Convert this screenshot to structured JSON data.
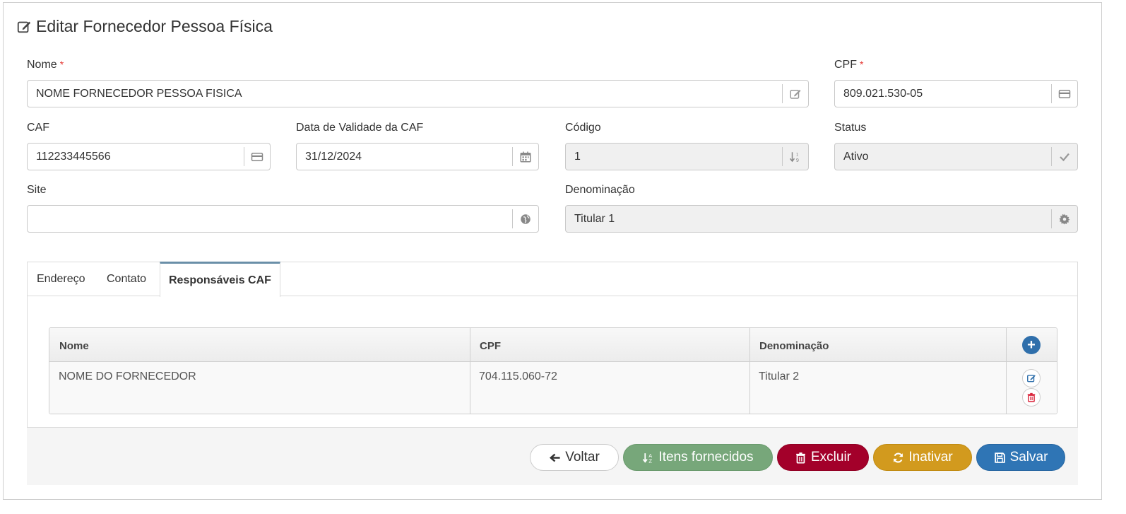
{
  "page": {
    "title": "Editar Fornecedor Pessoa Física"
  },
  "form": {
    "nome": {
      "label": "Nome",
      "required": "*",
      "value": "NOME FORNECEDOR PESSOA FISICA",
      "icon": "edit-icon"
    },
    "cpf": {
      "label": "CPF",
      "required": "*",
      "value": "809.021.530-05",
      "icon": "card-icon"
    },
    "caf": {
      "label": "CAF",
      "value": "112233445566",
      "icon": "card-icon"
    },
    "data_validade": {
      "label": "Data de Validade da CAF",
      "value": "31/12/2024",
      "icon": "calendar-icon"
    },
    "codigo": {
      "label": "Código",
      "value": "1",
      "icon": "sort-numeric-icon"
    },
    "status": {
      "label": "Status",
      "value": "Ativo",
      "icon": "check-icon"
    },
    "site": {
      "label": "Site",
      "value": "",
      "icon": "globe-icon"
    },
    "denominacao": {
      "label": "Denominação",
      "value": "Titular 1",
      "icon": "gear-icon"
    }
  },
  "tabs": [
    {
      "label": "Endereço",
      "active": false
    },
    {
      "label": "Contato",
      "active": false
    },
    {
      "label": "Responsáveis CAF",
      "active": true
    }
  ],
  "responsaveis_table": {
    "columns": [
      "Nome",
      "CPF",
      "Denominação"
    ],
    "rows": [
      {
        "nome": "NOME DO FORNECEDOR",
        "cpf": "704.115.060-72",
        "denominacao": "Titular 2"
      }
    ],
    "add_icon": "plus-icon"
  },
  "actions": {
    "voltar": "Voltar",
    "itens": "Itens fornecidos",
    "excluir": "Excluir",
    "inativar": "Inativar",
    "salvar": "Salvar"
  },
  "colors": {
    "itens": "#77a77a",
    "excluir": "#a3002a",
    "inativar": "#d29a1e",
    "salvar": "#2f75b5",
    "required": "#e53935",
    "tab_active_border": "#6a8fa8"
  }
}
